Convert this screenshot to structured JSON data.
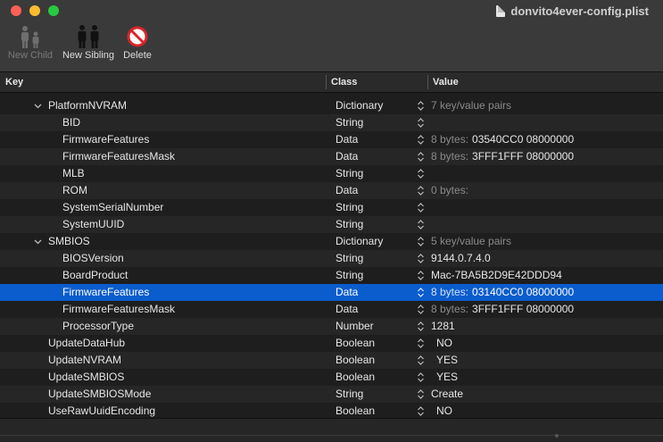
{
  "window": {
    "title": "donvito4ever-config.plist"
  },
  "toolbar": {
    "new_child": "New Child",
    "new_sibling": "New Sibling",
    "delete": "Delete"
  },
  "columns": {
    "key": "Key",
    "class": "Class",
    "value": "Value"
  },
  "rows": [
    {
      "key": "PlatformNVRAM",
      "class": "Dictionary",
      "prefix": "7 key/value pairs",
      "value": "",
      "indent": 1,
      "disclosure": true
    },
    {
      "key": "BID",
      "class": "String",
      "prefix": "",
      "value": "",
      "indent": 2,
      "disclosure": false
    },
    {
      "key": "FirmwareFeatures",
      "class": "Data",
      "prefix": "8 bytes:",
      "value": "03540CC0 08000000",
      "indent": 2,
      "disclosure": false
    },
    {
      "key": "FirmwareFeaturesMask",
      "class": "Data",
      "prefix": "8 bytes:",
      "value": "3FFF1FFF 08000000",
      "indent": 2,
      "disclosure": false
    },
    {
      "key": "MLB",
      "class": "String",
      "prefix": "",
      "value": "",
      "indent": 2,
      "disclosure": false
    },
    {
      "key": "ROM",
      "class": "Data",
      "prefix": "0 bytes:",
      "value": "",
      "indent": 2,
      "disclosure": false
    },
    {
      "key": "SystemSerialNumber",
      "class": "String",
      "prefix": "",
      "value": "",
      "indent": 2,
      "disclosure": false
    },
    {
      "key": "SystemUUID",
      "class": "String",
      "prefix": "",
      "value": "",
      "indent": 2,
      "disclosure": false
    },
    {
      "key": "SMBIOS",
      "class": "Dictionary",
      "prefix": "5 key/value pairs",
      "value": "",
      "indent": 1,
      "disclosure": true
    },
    {
      "key": "BIOSVersion",
      "class": "String",
      "prefix": "",
      "value": "9144.0.7.4.0",
      "indent": 2,
      "disclosure": false
    },
    {
      "key": "BoardProduct",
      "class": "String",
      "prefix": "",
      "value": "Mac-7BA5B2D9E42DDD94",
      "indent": 2,
      "disclosure": false
    },
    {
      "key": "FirmwareFeatures",
      "class": "Data",
      "prefix": "8 bytes:",
      "value": "03140CC0 08000000",
      "indent": 2,
      "disclosure": false,
      "selected": true
    },
    {
      "key": "FirmwareFeaturesMask",
      "class": "Data",
      "prefix": "8 bytes:",
      "value": "3FFF1FFF 08000000",
      "indent": 2,
      "disclosure": false
    },
    {
      "key": "ProcessorType",
      "class": "Number",
      "prefix": "",
      "value": "1281",
      "indent": 2,
      "disclosure": false
    },
    {
      "key": "UpdateDataHub",
      "class": "Boolean",
      "prefix": "",
      "value": "NO",
      "indent": 1,
      "disclosure": false,
      "bool": true
    },
    {
      "key": "UpdateNVRAM",
      "class": "Boolean",
      "prefix": "",
      "value": "YES",
      "indent": 1,
      "disclosure": false,
      "bool": true
    },
    {
      "key": "UpdateSMBIOS",
      "class": "Boolean",
      "prefix": "",
      "value": "YES",
      "indent": 1,
      "disclosure": false,
      "bool": true
    },
    {
      "key": "UpdateSMBIOSMode",
      "class": "String",
      "prefix": "",
      "value": "Create",
      "indent": 1,
      "disclosure": false
    },
    {
      "key": "UseRawUuidEncoding",
      "class": "Boolean",
      "prefix": "",
      "value": "NO",
      "indent": 1,
      "disclosure": false,
      "bool": true
    }
  ],
  "colors": {
    "selection": "#0b5ccc",
    "background": "#1e1e1e",
    "toolbar": "#3a3a3a"
  },
  "icons": {
    "new_child": "two-people-icon",
    "new_sibling": "two-people-icon",
    "delete": "no-entry-icon",
    "expanded": "chevron-down-icon",
    "stepper": "up-down-stepper-icon"
  }
}
